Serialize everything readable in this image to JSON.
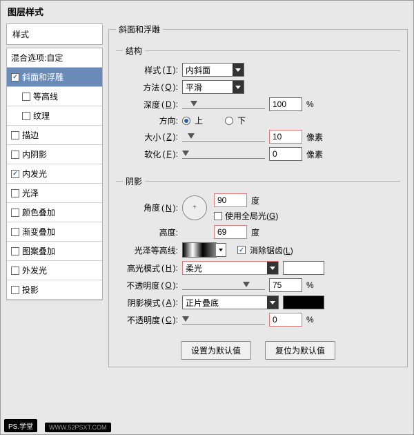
{
  "title": "图层样式",
  "sidebar": {
    "header": "样式",
    "blend": "混合选项:自定",
    "items": [
      {
        "label": "斜面和浮雕",
        "checked": true,
        "selected": true
      },
      {
        "label": "等高线",
        "checked": false,
        "child": true
      },
      {
        "label": "纹理",
        "checked": false,
        "child": true
      },
      {
        "label": "描边",
        "checked": false
      },
      {
        "label": "内阴影",
        "checked": false
      },
      {
        "label": "内发光",
        "checked": true
      },
      {
        "label": "光泽",
        "checked": false
      },
      {
        "label": "颜色叠加",
        "checked": false
      },
      {
        "label": "渐变叠加",
        "checked": false
      },
      {
        "label": "图案叠加",
        "checked": false
      },
      {
        "label": "外发光",
        "checked": false
      },
      {
        "label": "投影",
        "checked": false
      }
    ]
  },
  "panel": {
    "title": "斜面和浮雕",
    "structure": {
      "title": "结构",
      "style": {
        "label": "样式",
        "key": "T",
        "value": "内斜面"
      },
      "technique": {
        "label": "方法",
        "key": "Q",
        "value": "平滑"
      },
      "depth": {
        "label": "深度",
        "key": "D",
        "value": "100",
        "unit": "%"
      },
      "direction": {
        "label": "方向:",
        "up": "上",
        "down": "下"
      },
      "size": {
        "label": "大小",
        "key": "Z",
        "value": "10",
        "unit": "像素"
      },
      "soften": {
        "label": "软化",
        "key": "F",
        "value": "0",
        "unit": "像素"
      }
    },
    "shading": {
      "title": "阴影",
      "angle": {
        "label": "角度",
        "key": "N",
        "value": "90",
        "unit": "度"
      },
      "global": {
        "label": "使用全局光",
        "key": "G"
      },
      "altitude": {
        "label": "高度:",
        "value": "69",
        "unit": "度"
      },
      "gloss": {
        "label": "光泽等高线:",
        "anti": "消除锯齿",
        "antikey": "L"
      },
      "hmode": {
        "label": "高光模式",
        "key": "H",
        "value": "柔光"
      },
      "hopacity": {
        "label": "不透明度",
        "key": "O",
        "value": "75",
        "unit": "%"
      },
      "smode": {
        "label": "阴影模式",
        "key": "A",
        "value": "正片叠底"
      },
      "sopacity": {
        "label": "不透明度",
        "key": "C",
        "value": "0",
        "unit": "%"
      }
    },
    "buttons": {
      "default": "设置为默认值",
      "reset": "复位为默认值"
    }
  },
  "watermark": {
    "a": "PS.学堂",
    "b": "WWW.52PSXT.COM"
  }
}
